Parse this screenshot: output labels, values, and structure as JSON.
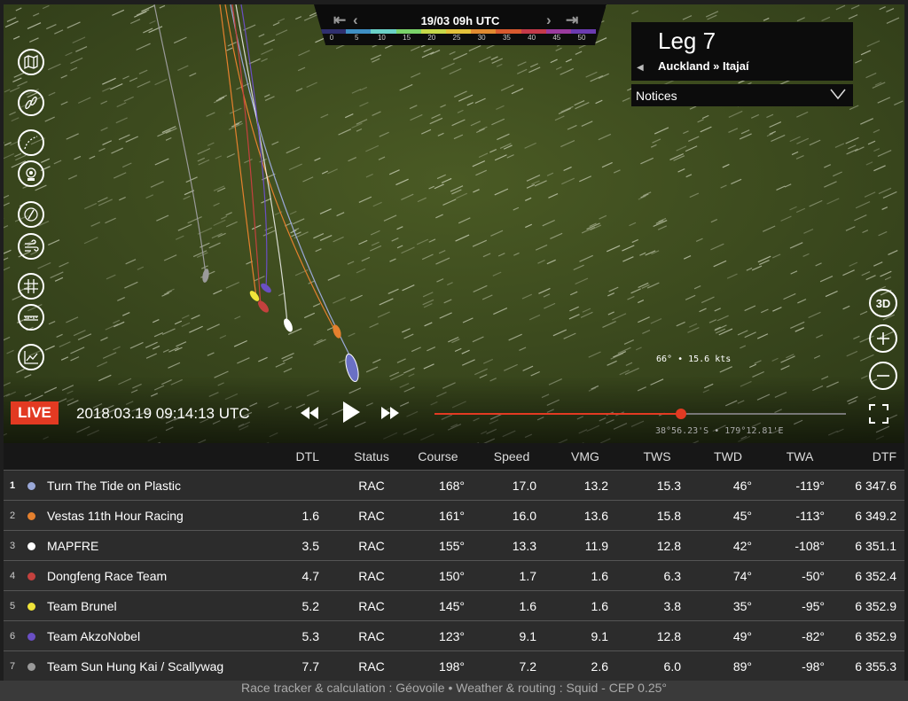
{
  "wind_header": {
    "date": "19/03 09h UTC",
    "scale": [
      {
        "label": "0",
        "color": "#2f2f6e"
      },
      {
        "label": "5",
        "color": "#3f8fc4"
      },
      {
        "label": "10",
        "color": "#6ad1c8"
      },
      {
        "label": "15",
        "color": "#7bd36a"
      },
      {
        "label": "20",
        "color": "#c6d84a"
      },
      {
        "label": "25",
        "color": "#e3c13b"
      },
      {
        "label": "30",
        "color": "#e08a31"
      },
      {
        "label": "35",
        "color": "#d85a2f"
      },
      {
        "label": "40",
        "color": "#c53a4a"
      },
      {
        "label": "45",
        "color": "#9a3b9e"
      },
      {
        "label": "50",
        "color": "#6b3bb0"
      }
    ]
  },
  "leg": {
    "title": "Leg 7",
    "route": "Auckland » Itajaí",
    "prev_arrow": "◀"
  },
  "notices": {
    "label": "Notices"
  },
  "left_tools": [
    {
      "name": "map-layers-icon"
    },
    {
      "name": "fleet-icon"
    },
    {
      "name": "routing-icon"
    },
    {
      "name": "camera-follow-icon"
    },
    {
      "name": "compass-icon"
    },
    {
      "name": "wind-icon"
    },
    {
      "name": "grid-icon"
    },
    {
      "name": "ruler-icon"
    },
    {
      "name": "chart-icon"
    }
  ],
  "right_tools": {
    "three_d": "3D"
  },
  "wind_readout": "66° • 15.6 kts",
  "coordinates": "38°56.23'S • 179°12.81'E",
  "playback": {
    "live": "LIVE",
    "datetime": "2018.03.19 09:14:13 UTC",
    "progress": 0.6
  },
  "table": {
    "headers": [
      "DTL",
      "Status",
      "Course",
      "Speed",
      "VMG",
      "TWS",
      "TWD",
      "TWA",
      "DTF"
    ],
    "rows": [
      {
        "pos": "1",
        "color": "#9aa8d8",
        "team": "Turn The Tide on Plastic",
        "dtl": "",
        "status": "RAC",
        "course": "168°",
        "speed": "17.0",
        "vmg": "13.2",
        "tws": "15.3",
        "twd": "46°",
        "twa": "-119°",
        "dtf": "6 347.6"
      },
      {
        "pos": "2",
        "color": "#e5802e",
        "team": "Vestas 11th Hour Racing",
        "dtl": "1.6",
        "status": "RAC",
        "course": "161°",
        "speed": "16.0",
        "vmg": "13.6",
        "tws": "15.8",
        "twd": "45°",
        "twa": "-113°",
        "dtf": "6 349.2"
      },
      {
        "pos": "3",
        "color": "#ffffff",
        "team": "MAPFRE",
        "dtl": "3.5",
        "status": "RAC",
        "course": "155°",
        "speed": "13.3",
        "vmg": "11.9",
        "tws": "12.8",
        "twd": "42°",
        "twa": "-108°",
        "dtf": "6 351.1"
      },
      {
        "pos": "4",
        "color": "#c4413e",
        "team": "Dongfeng Race Team",
        "dtl": "4.7",
        "status": "RAC",
        "course": "150°",
        "speed": "1.7",
        "vmg": "1.6",
        "tws": "6.3",
        "twd": "74°",
        "twa": "-50°",
        "dtf": "6 352.4"
      },
      {
        "pos": "5",
        "color": "#f0e43a",
        "team": "Team Brunel",
        "dtl": "5.2",
        "status": "RAC",
        "course": "145°",
        "speed": "1.6",
        "vmg": "1.6",
        "tws": "3.8",
        "twd": "35°",
        "twa": "-95°",
        "dtf": "6 352.9"
      },
      {
        "pos": "6",
        "color": "#6a4fc4",
        "team": "Team AkzoNobel",
        "dtl": "5.3",
        "status": "RAC",
        "course": "123°",
        "speed": "9.1",
        "vmg": "9.1",
        "tws": "12.8",
        "twd": "49°",
        "twa": "-82°",
        "dtf": "6 352.9"
      },
      {
        "pos": "7",
        "color": "#9a9a9a",
        "team": "Team Sun Hung Kai / Scallywag",
        "dtl": "7.7",
        "status": "RAC",
        "course": "198°",
        "speed": "7.2",
        "vmg": "2.6",
        "tws": "6.0",
        "twd": "89°",
        "twa": "-98°",
        "dtf": "6 355.3"
      }
    ]
  },
  "footer": "Race tracker & calculation : Géovoile • Weather & routing : Squid - CEP 0.25°"
}
